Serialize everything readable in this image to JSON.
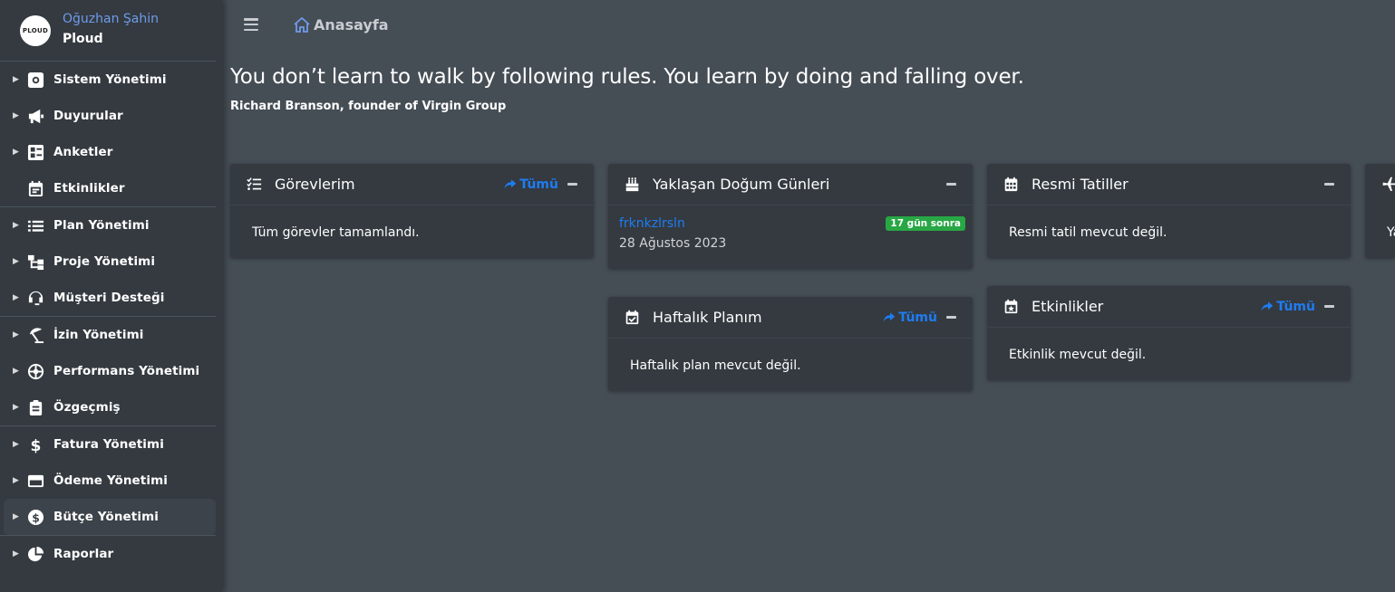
{
  "brand": {
    "logo_text": "PLOUD",
    "user_name": "Oğuzhan Şahin",
    "company": "Ploud"
  },
  "sidebar": {
    "groups": [
      [
        {
          "label": "Sistem Yönetimi",
          "icon": "gear-icon"
        },
        {
          "label": "Duyurular",
          "icon": "megaphone-icon"
        },
        {
          "label": "Anketler",
          "icon": "poll-icon"
        },
        {
          "label": "Etkinlikler",
          "icon": "calendar-icon"
        }
      ],
      [
        {
          "label": "Plan Yönetimi",
          "icon": "list-icon"
        },
        {
          "label": "Proje Yönetimi",
          "icon": "sitemap-icon"
        },
        {
          "label": "Müşteri Desteği",
          "icon": "headset-icon"
        }
      ],
      [
        {
          "label": "İzin Yönetimi",
          "icon": "umbrella-beach-icon"
        },
        {
          "label": "Performans Yönetimi",
          "icon": "dharmachakra-icon"
        },
        {
          "label": "Özgeçmiş",
          "icon": "clipboard-icon"
        }
      ],
      [
        {
          "label": "Fatura Yönetimi",
          "icon": "dollar-icon"
        },
        {
          "label": "Ödeme Yönetimi",
          "icon": "credit-card-icon"
        },
        {
          "label": "Bütçe Yönetimi",
          "icon": "dollar-circle-icon"
        }
      ],
      [
        {
          "label": "Raporlar",
          "icon": "pie-chart-icon"
        }
      ]
    ]
  },
  "header": {
    "page_title": "Anasayfa"
  },
  "quote": {
    "text": "You don’t learn to walk by following rules. You learn by doing and falling over.",
    "author": "Richard Branson, founder of Virgin Group"
  },
  "cards": {
    "tasks": {
      "title": "Görevlerim",
      "all_label": "Tümü",
      "body": "Tüm görevler tamamlandı."
    },
    "birthdays": {
      "title": "Yaklaşan Doğum Günleri",
      "name": "frknkzlrsln",
      "date": "28 Ağustos 2023",
      "badge": "17 gün sonra"
    },
    "weekly": {
      "title": "Haftalık Planım",
      "all_label": "Tümü",
      "body": "Haftalık plan mevcut değil."
    },
    "holidays": {
      "title": "Resmi Tatiller",
      "body": "Resmi tatil mevcut değil."
    },
    "events": {
      "title": "Etkinlikler",
      "all_label": "Tümü",
      "body": "Etkinlik mevcut değil."
    },
    "partial": {
      "body_fragment": "Ya"
    }
  },
  "colors": {
    "link": "#1e7cf2",
    "badge": "#28a745",
    "sidebar_bg": "#343a40",
    "content_bg": "#454d55"
  }
}
